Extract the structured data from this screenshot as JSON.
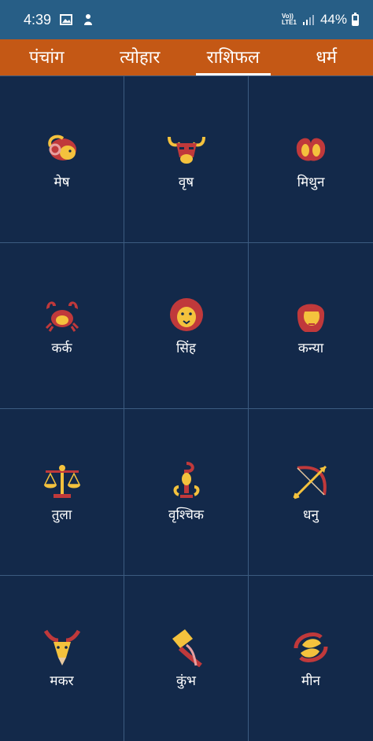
{
  "status_bar": {
    "time": "4:39",
    "network_line1": "Vo))",
    "network_line2": "LTE1",
    "battery": "44%"
  },
  "tabs": [
    {
      "label": "पंचांग",
      "active": false
    },
    {
      "label": "त्योहार",
      "active": false
    },
    {
      "label": "राशिफल",
      "active": true
    },
    {
      "label": "धर्म",
      "active": false
    }
  ],
  "signs": [
    {
      "label": "मेष",
      "icon": "aries-icon"
    },
    {
      "label": "वृष",
      "icon": "taurus-icon"
    },
    {
      "label": "मिथुन",
      "icon": "gemini-icon"
    },
    {
      "label": "कर्क",
      "icon": "cancer-icon"
    },
    {
      "label": "सिंह",
      "icon": "leo-icon"
    },
    {
      "label": "कन्या",
      "icon": "virgo-icon"
    },
    {
      "label": "तुला",
      "icon": "libra-icon"
    },
    {
      "label": "वृश्चिक",
      "icon": "scorpio-icon"
    },
    {
      "label": "धनु",
      "icon": "sagittarius-icon"
    },
    {
      "label": "मकर",
      "icon": "capricorn-icon"
    },
    {
      "label": "कुंभ",
      "icon": "aquarius-icon"
    },
    {
      "label": "मीन",
      "icon": "pisces-icon"
    }
  ],
  "colors": {
    "status_bar": "#275e86",
    "tab_bar": "#c45815",
    "background": "#13294a",
    "icon_red": "#c0393b",
    "icon_gold": "#f4c23d"
  }
}
